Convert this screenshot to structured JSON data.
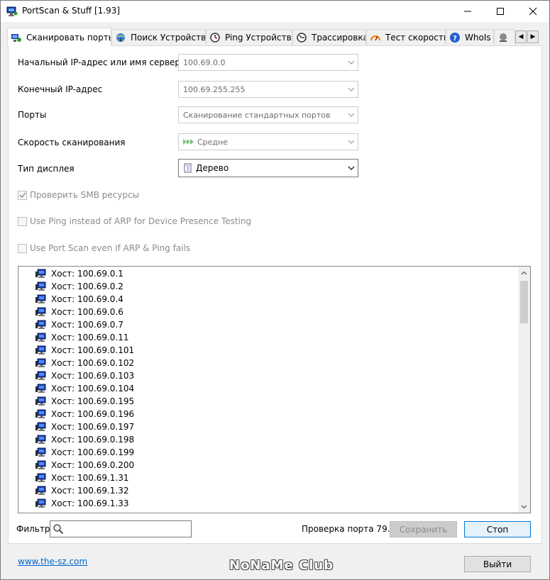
{
  "window": {
    "title": "PortScan & Stuff [1.93]",
    "minimize_icon": "minimize-icon",
    "maximize_icon": "maximize-icon",
    "close_icon": "close-icon"
  },
  "tabs": [
    {
      "label": "Сканировать порты",
      "icon": "globe-scan-icon",
      "active": true
    },
    {
      "label": "Поиск Устройства",
      "icon": "globe-search-icon"
    },
    {
      "label": "Ping Устройства",
      "icon": "ping-clock-icon"
    },
    {
      "label": "Трассировка",
      "icon": "traceroute-clock-icon"
    },
    {
      "label": "Тест скорости",
      "icon": "speedometer-icon"
    },
    {
      "label": "WhoIs",
      "icon": "question-icon"
    },
    {
      "label": "",
      "icon": "network-icon"
    }
  ],
  "tab_scroll": {
    "left": "◀",
    "right": "▶"
  },
  "form": {
    "start_ip_label": "Начальный IP-адрес или имя сервера",
    "start_ip_value": "100.69.0.0",
    "end_ip_label": "Конечный IP-адрес",
    "end_ip_value": "100.69.255.255",
    "ports_label": "Порты",
    "ports_value": "Сканирование стандартных портов",
    "speed_label": "Скорость сканирования",
    "speed_value": "Средне",
    "display_label": "Тип дисплея",
    "display_value": "Дерево"
  },
  "checkboxes": [
    {
      "label": "Проверить SMB ресурсы",
      "checked": true
    },
    {
      "label": "Use Ping instead of ARP for Device Presence Testing",
      "checked": false
    },
    {
      "label": "Use Port Scan even if ARP & Ping fails",
      "checked": false
    }
  ],
  "hosts": [
    "Хост: 100.69.0.1",
    "Хост: 100.69.0.2",
    "Хост: 100.69.0.4",
    "Хост: 100.69.0.6",
    "Хост: 100.69.0.7",
    "Хост: 100.69.0.11",
    "Хост: 100.69.0.101",
    "Хост: 100.69.0.102",
    "Хост: 100.69.0.103",
    "Хост: 100.69.0.104",
    "Хост: 100.69.0.195",
    "Хост: 100.69.0.196",
    "Хост: 100.69.0.197",
    "Хост: 100.69.0.198",
    "Хост: 100.69.0.199",
    "Хост: 100.69.0.200",
    "Хост: 100.69.1.31",
    "Хост: 100.69.1.32",
    "Хост: 100.69.1.33"
  ],
  "footer": {
    "filter_label": "Фильтр",
    "filter_value": "",
    "status": "Проверка порта 79...",
    "save_label": "Сохранить",
    "stop_label": "Стоп",
    "exit_label": "Выйти",
    "link": "www.the-sz.com",
    "watermark": "NoNaMe Club"
  },
  "colors": {
    "accent": "#0078d7",
    "link": "#0066cc",
    "host_icon": "#1f3fa8"
  }
}
